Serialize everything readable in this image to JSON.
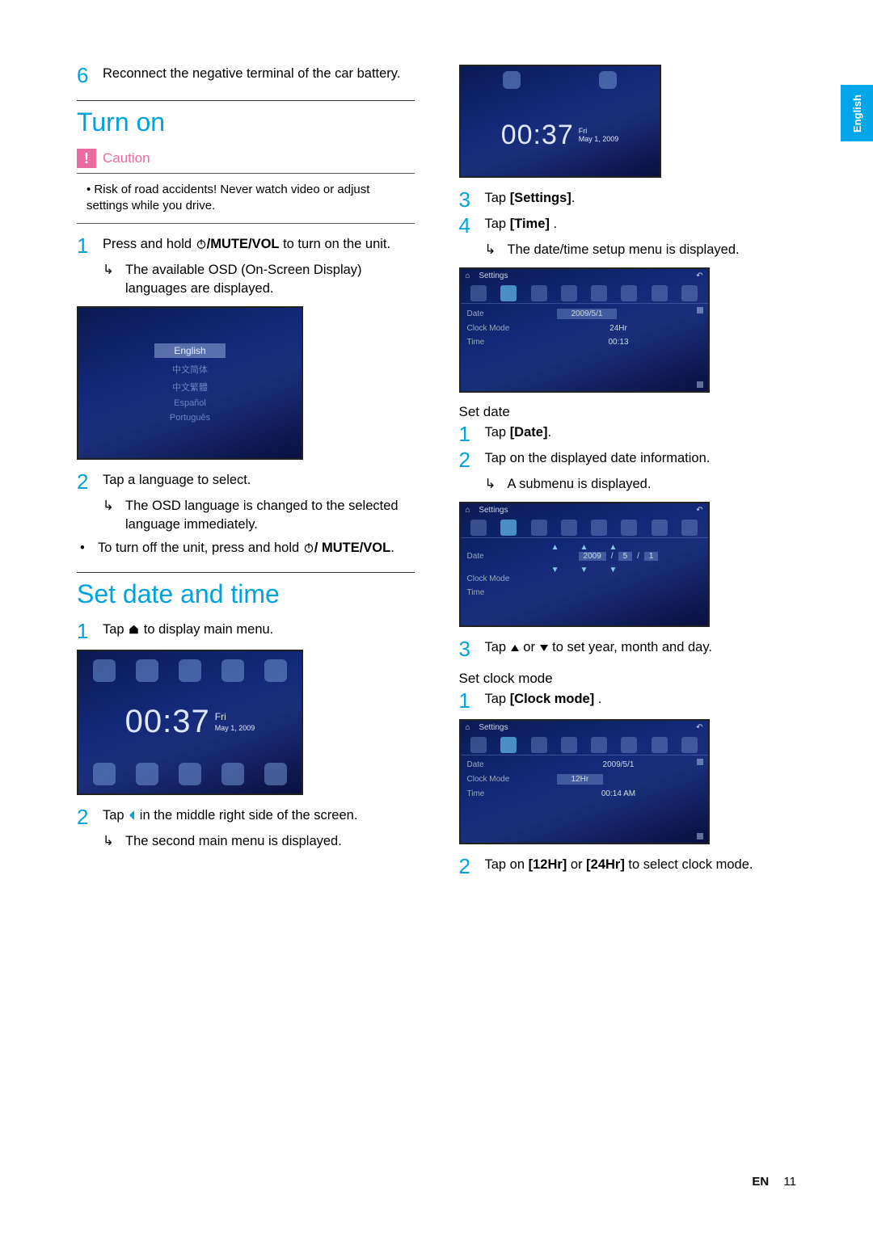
{
  "side_tab": "English",
  "left": {
    "step6": {
      "num": "6",
      "text": "Reconnect the negative terminal of the car battery."
    },
    "section1": "Turn on",
    "caution": {
      "title": "Caution",
      "bullet": "Risk of road accidents! Never watch video or adjust settings while you drive."
    },
    "turnon": {
      "s1": {
        "num": "1",
        "a": "Press and hold ",
        "b": "/MUTE/VOL",
        "c": " to turn on the unit."
      },
      "s1arrow": "The available OSD (On-Screen Display) languages are displayed.",
      "langshot": {
        "sel": "English",
        "o1": "中文简体",
        "o2": "中文繁體",
        "o3": "Español",
        "o4": "Português"
      },
      "s2": {
        "num": "2",
        "text": "Tap a language to select."
      },
      "s2arrow": "The OSD language is changed to the selected language immediately.",
      "off_a": "To turn off the unit, press and hold ",
      "off_b": "/ MUTE/VOL",
      "off_c": "."
    },
    "section2": "Set date and time",
    "sdt": {
      "s1": {
        "num": "1",
        "a": "Tap ",
        "b": " to display main menu."
      },
      "clockshot": {
        "time": "00:37",
        "day": "Fri",
        "date": "May 1, 2009"
      },
      "s2": {
        "num": "2",
        "a": "Tap ",
        "b": " in the middle right side of the screen."
      },
      "s2arrow": "The second main menu is displayed."
    }
  },
  "right": {
    "clockshot2": {
      "time": "00:37",
      "day": "Fri",
      "date": "May 1, 2009"
    },
    "s3": {
      "num": "3",
      "a": "Tap ",
      "b": "[Settings]",
      "c": "."
    },
    "s4": {
      "num": "4",
      "a": "Tap ",
      "b": "[Time]",
      "c": " ."
    },
    "s4arrow": "The date/time setup menu is displayed.",
    "settings1": {
      "header": "Settings",
      "r1l": "Date",
      "r1v": "2009/5/1",
      "r2l": "Clock Mode",
      "r2v": "24Hr",
      "r3l": "Time",
      "r3v": "00:13"
    },
    "setdate": {
      "title": "Set date",
      "s1": {
        "num": "1",
        "a": "Tap ",
        "b": "[Date]",
        "c": "."
      },
      "s2": {
        "num": "2",
        "text": "Tap on the displayed date information."
      },
      "s2arrow": "A submenu is displayed."
    },
    "settings2": {
      "header": "Settings",
      "r1l": "Date",
      "y": "2009",
      "m": "5",
      "d": "1",
      "r2l": "Clock Mode",
      "r3l": "Time"
    },
    "s3b": {
      "num": "3",
      "a": "Tap ",
      "b": " or ",
      "c": " to set year, month and day."
    },
    "setclock": {
      "title": "Set clock mode",
      "s1": {
        "num": "1",
        "a": "Tap ",
        "b": "[Clock mode]",
        "c": " ."
      }
    },
    "settings3": {
      "header": "Settings",
      "r1l": "Date",
      "r1v": "2009/5/1",
      "r2l": "Clock Mode",
      "r2v": "12Hr",
      "r3l": "Time",
      "r3v": "00:14  AM"
    },
    "s2b": {
      "num": "2",
      "a": "Tap on ",
      "b": "[12Hr]",
      "c": " or ",
      "d": "[24Hr]",
      "e": " to select clock mode."
    }
  },
  "footer": {
    "en": "EN",
    "page": "11"
  }
}
